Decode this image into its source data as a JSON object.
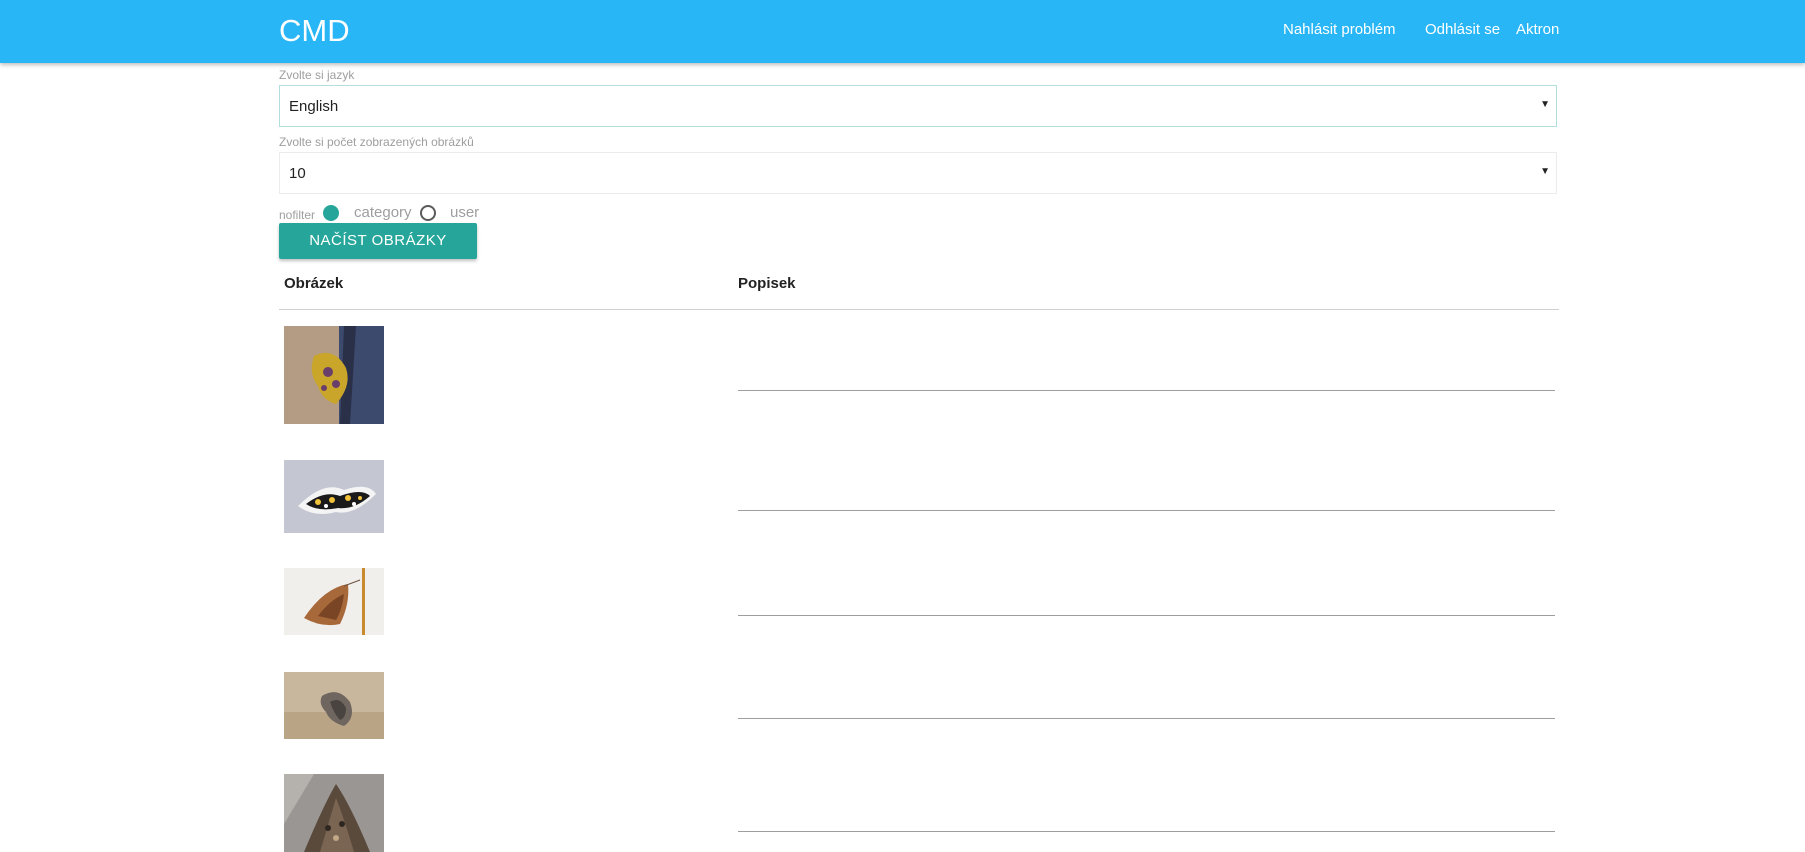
{
  "header": {
    "brand": "CMD",
    "nav": {
      "report_problem": "Nahlásit problém",
      "logout": "Odhlásit se",
      "user": "Aktron"
    }
  },
  "form": {
    "language_label": "Zvolte si jazyk",
    "language_value": "English",
    "count_label": "Zvolte si počet zobrazených obrázků",
    "count_value": "10",
    "filter": {
      "nofilter_label": "nofilter",
      "category_label": "category",
      "user_label": "user",
      "selected": "nofilter"
    },
    "load_button": "NAČÍST OBRÁZKY"
  },
  "table": {
    "columns": [
      "Obrázek",
      "Popisek"
    ],
    "rows": [
      {
        "image": "moth-on-bark-yellow-spotted",
        "description": ""
      },
      {
        "image": "moth-black-white-yellow-wings",
        "description": ""
      },
      {
        "image": "moth-brown-on-white",
        "description": ""
      },
      {
        "image": "moth-gray-on-sand",
        "description": ""
      },
      {
        "image": "moth-dark-brown-patterned",
        "description": ""
      }
    ]
  },
  "colors": {
    "navbar": "#29b6f6",
    "accent": "#26a69a"
  }
}
